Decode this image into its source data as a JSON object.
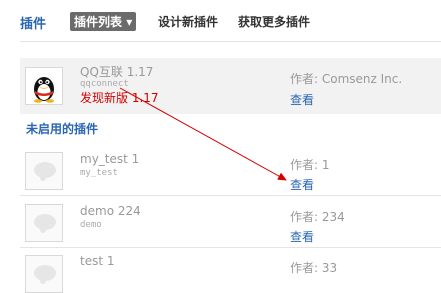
{
  "header": {
    "title": "插件",
    "tabs": [
      {
        "label": "插件列表",
        "dropdown": "▾",
        "active": true
      },
      {
        "label": "设计新插件",
        "active": false
      },
      {
        "label": "获取更多插件",
        "active": false
      }
    ]
  },
  "enabled_plugins": [
    {
      "name": "QQ互联 1.17",
      "identifier": "qqconnect",
      "update_notice": "发现新版 1.17",
      "author": "作者: Comsenz Inc.",
      "view_label": "查看",
      "icon": "qq-penguin-icon"
    }
  ],
  "disabled_section": {
    "heading": "未启用的插件"
  },
  "disabled_plugins": [
    {
      "name": "my_test 1",
      "identifier": "my_test",
      "author": "作者: 1",
      "view_label": "查看"
    },
    {
      "name": "demo 224",
      "identifier": "demo",
      "author": "作者: 234",
      "view_label": "查看"
    },
    {
      "name": "test 1",
      "identifier": "",
      "author": "作者: 33",
      "view_label": "查看"
    }
  ],
  "colors": {
    "link": "#2b66b1",
    "notice": "#d40000",
    "annotation_arrow": "#d40000",
    "enabled_row_bg": "#f2f2f2"
  }
}
